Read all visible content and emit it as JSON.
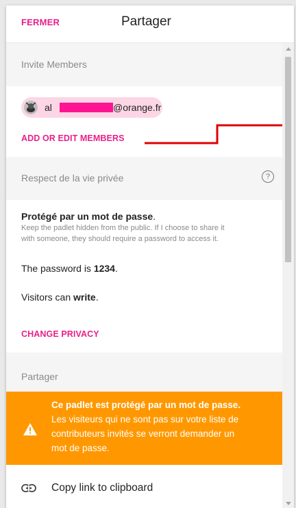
{
  "header": {
    "close_label": "FERMER",
    "title": "Partager"
  },
  "invite": {
    "heading": "Invite Members",
    "member_prefix": "al",
    "member_domain": "@orange.fr",
    "add_label": "ADD OR EDIT MEMBERS"
  },
  "privacy": {
    "heading": "Respect de la vie privée",
    "help_icon": "?",
    "mode_title": "Protégé par un mot de passe",
    "mode_period": ".",
    "description_line1": "Keep the padlet hidden from the public. If I choose to share it",
    "description_line2": "with someone, they should require a password to access it.",
    "password_prefix": "The password is ",
    "password_value": "1234",
    "password_suffix": ".",
    "visitors_prefix": "Visitors can ",
    "visitors_value": "write",
    "visitors_suffix": ".",
    "change_label": "CHANGE PRIVACY"
  },
  "share": {
    "heading": "Partager",
    "banner_bold": "Ce padlet est protégé par un mot de passe.",
    "banner_line2": "Les visiteurs qui ne sont pas sur votre liste de",
    "banner_line3": "contributeurs invités se verront demander un",
    "banner_line4": "mot de passe.",
    "copy_link_label": "Copy link to clipboard"
  },
  "colors": {
    "accent": "#e8208a",
    "warning": "#ff9800",
    "chip": "#fcd6e5",
    "annotation": "#e00000"
  },
  "icons": {
    "help": "question-circle-icon",
    "warning": "warning-triangle-icon",
    "link": "link-icon",
    "avatar": "user-avatar-icon"
  }
}
